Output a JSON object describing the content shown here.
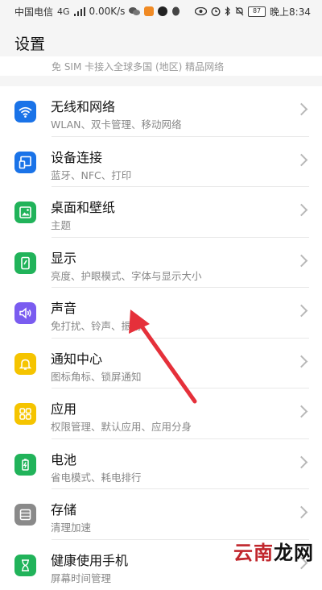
{
  "status_bar": {
    "carrier": "中国电信",
    "network": "4G",
    "speed": "0.00K/s",
    "battery": "87",
    "time": "晚上8:34"
  },
  "header": {
    "title": "设置"
  },
  "top_cut_text": "免 SIM 卡接入全球多国 (地区) 精品网络",
  "items": [
    {
      "title": "无线和网络",
      "subtitle": "WLAN、双卡管理、移动网络",
      "icon": "wifi-icon",
      "color": "#1a73e8"
    },
    {
      "title": "设备连接",
      "subtitle": "蓝牙、NFC、打印",
      "icon": "device-connect-icon",
      "color": "#1a73e8"
    },
    {
      "title": "桌面和壁纸",
      "subtitle": "主题",
      "icon": "wallpaper-icon",
      "color": "#21b35a"
    },
    {
      "title": "显示",
      "subtitle": "亮度、护眼模式、字体与显示大小",
      "icon": "display-icon",
      "color": "#21b35a"
    },
    {
      "title": "声音",
      "subtitle": "免打扰、铃声、振动",
      "icon": "sound-icon",
      "color": "#7a5cf0"
    },
    {
      "title": "通知中心",
      "subtitle": "图标角标、锁屏通知",
      "icon": "bell-icon",
      "color": "#f5c400"
    },
    {
      "title": "应用",
      "subtitle": "权限管理、默认应用、应用分身",
      "icon": "apps-icon",
      "color": "#f5c400"
    },
    {
      "title": "电池",
      "subtitle": "省电模式、耗电排行",
      "icon": "battery-icon",
      "color": "#21b35a"
    },
    {
      "title": "存储",
      "subtitle": "清理加速",
      "icon": "storage-icon",
      "color": "#8a8a8a"
    },
    {
      "title": "健康使用手机",
      "subtitle": "屏幕时间管理",
      "icon": "hourglass-icon",
      "color": "#21b35a"
    }
  ],
  "watermark": {
    "part1": "云南",
    "part2": "龙网"
  }
}
